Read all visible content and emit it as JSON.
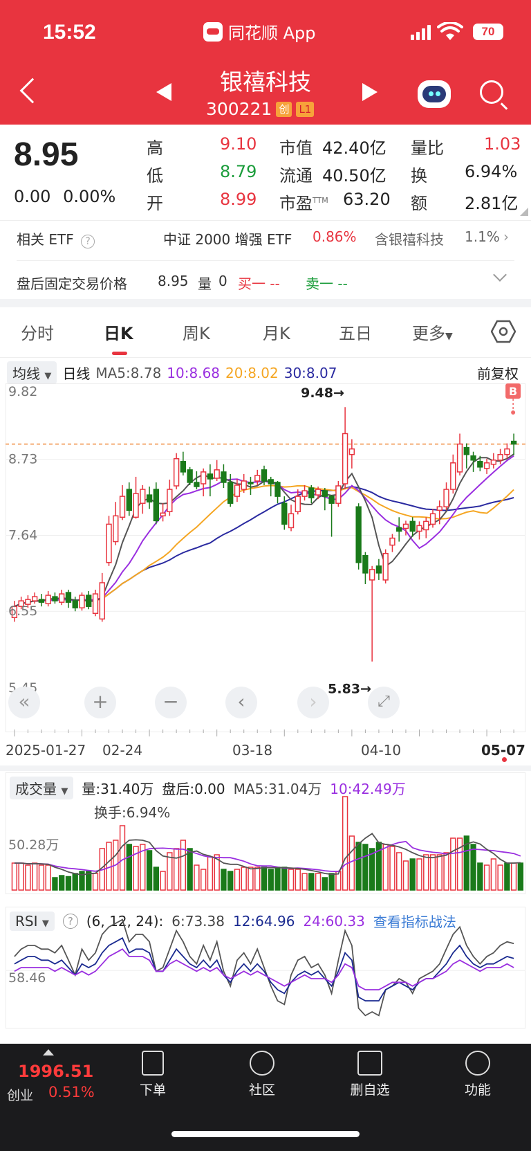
{
  "status_bar": {
    "time": "15:52",
    "app_label": "同花顺 App",
    "battery": "70"
  },
  "header": {
    "stock_name": "银禧科技",
    "stock_code": "300221",
    "tag_board": "创",
    "tag_level": "L1"
  },
  "quote": {
    "price": "8.95",
    "change": "0.00",
    "change_pct": "0.00%",
    "rows": [
      {
        "l1": "高",
        "v1": "9.10",
        "l2": "市值",
        "v2": "42.40亿",
        "l3": "量比",
        "v3": "1.03"
      },
      {
        "l1": "低",
        "v1": "8.79",
        "l2": "流通",
        "v2": "40.50亿",
        "l3": "换",
        "v3": "6.94%"
      },
      {
        "l1": "开",
        "v1": "8.99",
        "l2": "市盈",
        "v2": "63.20",
        "l3": "额",
        "v3": "2.81亿"
      }
    ],
    "ttm": "TTM"
  },
  "etf": {
    "label": "相关 ETF",
    "name": "中证 2000 增强 ETF",
    "pct": "0.86%",
    "contains": "含银禧科技",
    "weight": "1.1%"
  },
  "after_hours": {
    "label": "盘后固定交易价格",
    "price": "8.95",
    "vol_label": "量",
    "vol": "0",
    "buy": "买一 --",
    "sell": "卖一 --"
  },
  "tabs": [
    "分时",
    "日K",
    "周K",
    "月K",
    "五日",
    "更多"
  ],
  "kline": {
    "chip": "均线",
    "period": "日线",
    "ma5": "MA5:8.78",
    "ma10": "10:8.68",
    "ma20": "20:8.02",
    "ma30": "30:8.07",
    "adjust": "前复权",
    "y_labels": [
      "9.82",
      "8.73",
      "7.64",
      "6.55",
      "5.45"
    ],
    "high_mark": "9.48→",
    "low_mark": "5.83→",
    "b_mark": "B",
    "dates": [
      "2025-01-27",
      "02-24",
      "03-18",
      "04-10",
      "05-07"
    ]
  },
  "volume": {
    "chip": "成交量",
    "vol": "量:31.40万",
    "after": "盘后:0.00",
    "ma5": "MA5:31.04万",
    "ma10": "10:42.49万",
    "turnover": "换手:6.94%",
    "y_label": "50.28万"
  },
  "rsi": {
    "chip": "RSI",
    "params": "(6, 12, 24):",
    "r6": "6:73.38",
    "r12": "12:64.96",
    "r24": "24:60.33",
    "link": "查看指标战法",
    "y_label": "58.46"
  },
  "bottom": {
    "index_value": "1996.51",
    "index_name": "创业",
    "index_pct": "0.51%",
    "nav": [
      "下单",
      "社区",
      "删自选",
      "功能"
    ]
  },
  "colors": {
    "up": "#e8343f",
    "down": "#1a7a1a",
    "ma5": "#555555",
    "ma10": "#9a2fe0",
    "ma20": "#f5a623",
    "ma30": "#2a2aa0"
  },
  "chart_data": [
    {
      "type": "candlestick",
      "title": "",
      "ylim": [
        5.45,
        9.82
      ],
      "x_ticks": [
        "2025-01-27",
        "02-24",
        "03-18",
        "04-10",
        "05-07"
      ],
      "candles": [
        [
          6.46,
          6.62,
          6.7,
          6.4
        ],
        [
          6.62,
          6.7,
          6.76,
          6.58
        ],
        [
          6.65,
          6.72,
          6.78,
          6.6
        ],
        [
          6.7,
          6.76,
          6.82,
          6.66
        ],
        [
          6.72,
          6.68,
          6.8,
          6.62
        ],
        [
          6.66,
          6.78,
          6.84,
          6.62
        ],
        [
          6.76,
          6.7,
          6.82,
          6.66
        ],
        [
          6.68,
          6.8,
          6.86,
          6.64
        ],
        [
          6.82,
          6.68,
          6.86,
          6.6
        ],
        [
          6.7,
          6.6,
          6.76,
          6.55
        ],
        [
          6.6,
          6.78,
          6.82,
          6.56
        ],
        [
          6.78,
          6.62,
          6.84,
          6.58
        ],
        [
          6.52,
          6.8,
          6.86,
          6.48
        ],
        [
          6.44,
          6.96,
          7.1,
          6.4
        ],
        [
          7.25,
          7.8,
          7.92,
          7.2
        ],
        [
          7.55,
          7.92,
          8.12,
          7.5
        ],
        [
          7.9,
          8.2,
          8.36,
          7.86
        ],
        [
          8.3,
          8.0,
          8.4,
          7.92
        ],
        [
          7.9,
          8.24,
          8.48,
          7.88
        ],
        [
          8.1,
          8.3,
          8.36,
          7.95
        ],
        [
          8.22,
          8.12,
          8.34,
          8.02
        ],
        [
          8.3,
          7.85,
          8.4,
          7.8
        ],
        [
          7.92,
          7.96,
          8.1,
          7.84
        ],
        [
          7.98,
          8.3,
          8.44,
          7.92
        ],
        [
          8.35,
          8.74,
          8.82,
          8.3
        ],
        [
          8.7,
          8.55,
          8.84,
          8.5
        ],
        [
          8.58,
          8.4,
          8.62,
          8.36
        ],
        [
          8.4,
          8.34,
          8.56,
          8.3
        ],
        [
          8.38,
          8.55,
          8.6,
          8.2
        ],
        [
          8.52,
          8.45,
          8.66,
          8.2
        ],
        [
          8.46,
          8.58,
          8.72,
          8.42
        ],
        [
          8.55,
          8.4,
          8.66,
          8.32
        ],
        [
          8.4,
          8.1,
          8.52,
          8.05
        ],
        [
          8.2,
          8.36,
          8.45,
          8.12
        ],
        [
          8.3,
          8.42,
          8.52,
          8.25
        ],
        [
          8.4,
          8.38,
          8.48,
          8.22
        ],
        [
          8.42,
          8.5,
          8.58,
          8.36
        ],
        [
          8.58,
          8.42,
          8.64,
          8.36
        ],
        [
          8.44,
          8.38,
          8.48,
          8.2
        ],
        [
          8.4,
          8.2,
          8.42,
          8.1
        ],
        [
          8.1,
          7.8,
          8.2,
          7.72
        ],
        [
          7.75,
          7.95,
          8.08,
          7.7
        ],
        [
          7.98,
          8.2,
          8.3,
          7.94
        ],
        [
          8.2,
          8.28,
          8.36,
          8.14
        ],
        [
          8.32,
          8.18,
          8.36,
          8.1
        ],
        [
          8.22,
          8.3,
          8.34,
          8.16
        ],
        [
          8.28,
          8.2,
          8.32,
          8.0
        ],
        [
          8.2,
          8.1,
          8.22,
          7.62
        ],
        [
          8.1,
          8.35,
          8.42,
          8.05
        ],
        [
          8.38,
          9.1,
          9.48,
          8.3
        ],
        [
          8.8,
          8.88,
          9.02,
          8.6
        ],
        [
          8.05,
          7.25,
          8.1,
          7.15
        ],
        [
          7.35,
          7.1,
          7.4,
          6.94
        ],
        [
          7.0,
          7.15,
          7.2,
          5.83
        ],
        [
          7.2,
          7.1,
          7.3,
          7.0
        ],
        [
          7.0,
          7.38,
          7.44,
          6.95
        ],
        [
          7.5,
          7.6,
          7.66,
          7.4
        ],
        [
          7.75,
          7.7,
          7.9,
          7.55
        ],
        [
          7.74,
          7.8,
          7.85,
          7.64
        ],
        [
          7.84,
          7.7,
          7.9,
          7.62
        ],
        [
          7.7,
          7.78,
          7.84,
          7.58
        ],
        [
          7.72,
          7.84,
          7.9,
          7.6
        ],
        [
          7.8,
          7.95,
          8.02,
          7.75
        ],
        [
          8.0,
          8.05,
          8.14,
          7.8
        ],
        [
          8.05,
          8.3,
          8.4,
          8.0
        ],
        [
          8.3,
          8.68,
          8.8,
          8.24
        ],
        [
          8.55,
          8.95,
          9.1,
          8.5
        ],
        [
          8.9,
          8.8,
          8.96,
          8.6
        ],
        [
          8.78,
          8.72,
          8.84,
          8.55
        ],
        [
          8.7,
          8.62,
          8.78,
          8.56
        ],
        [
          8.6,
          8.68,
          8.74,
          8.52
        ],
        [
          8.66,
          8.72,
          8.82,
          8.6
        ],
        [
          8.72,
          8.8,
          8.88,
          8.66
        ],
        [
          8.8,
          8.88,
          8.96,
          8.74
        ],
        [
          8.99,
          8.95,
          9.1,
          8.79
        ]
      ]
    },
    {
      "type": "bar",
      "title": "",
      "ylabel": "成交量",
      "ylim": [
        0,
        100
      ],
      "values": [
        26,
        26,
        24,
        26,
        24,
        24,
        12,
        14,
        13,
        16,
        18,
        18,
        16,
        40,
        46,
        48,
        62,
        44,
        42,
        44,
        38,
        22,
        18,
        36,
        40,
        48,
        40,
        24,
        20,
        32,
        34,
        20,
        18,
        20,
        22,
        22,
        22,
        22,
        20,
        22,
        22,
        20,
        20,
        16,
        16,
        16,
        12,
        16,
        18,
        90,
        52,
        46,
        44,
        40,
        46,
        44,
        42,
        36,
        28,
        30,
        30,
        34,
        34,
        34,
        36,
        50,
        50,
        52,
        44,
        26,
        24,
        30,
        24,
        26,
        26,
        26
      ],
      "down_days": [
        6,
        7,
        8,
        9,
        10,
        11,
        17,
        20,
        21,
        26,
        31,
        32,
        37,
        38,
        39,
        40,
        44,
        46,
        47,
        51,
        52,
        53,
        54,
        59,
        67,
        68,
        69,
        73,
        75
      ]
    },
    {
      "type": "line",
      "title": "",
      "series": [
        {
          "name": "RSI6",
          "values": [
            66,
            70,
            72,
            72,
            70,
            70,
            68,
            72,
            64,
            56,
            70,
            64,
            68,
            78,
            82,
            84,
            86,
            74,
            78,
            78,
            74,
            58,
            60,
            70,
            80,
            74,
            66,
            62,
            72,
            64,
            74,
            58,
            50,
            64,
            68,
            62,
            70,
            60,
            50,
            42,
            40,
            56,
            64,
            66,
            60,
            62,
            56,
            46,
            64,
            80,
            72,
            38,
            34,
            36,
            34,
            48,
            50,
            54,
            52,
            46,
            54,
            56,
            58,
            62,
            70,
            78,
            82,
            72,
            66,
            62,
            66,
            68,
            72,
            74,
            73
          ]
        },
        {
          "name": "RSI12",
          "values": [
            62,
            64,
            66,
            66,
            64,
            64,
            62,
            64,
            60,
            56,
            62,
            60,
            62,
            68,
            72,
            74,
            76,
            68,
            70,
            70,
            68,
            58,
            58,
            64,
            70,
            66,
            62,
            60,
            64,
            60,
            64,
            56,
            52,
            58,
            62,
            58,
            62,
            58,
            52,
            48,
            46,
            52,
            56,
            58,
            56,
            58,
            54,
            50,
            58,
            68,
            64,
            44,
            42,
            42,
            42,
            48,
            50,
            52,
            50,
            48,
            52,
            54,
            54,
            58,
            62,
            68,
            72,
            66,
            62,
            60,
            62,
            62,
            64,
            66,
            65
          ]
        },
        {
          "name": "RSI24",
          "values": [
            58,
            60,
            60,
            60,
            60,
            60,
            58,
            60,
            58,
            56,
            58,
            56,
            58,
            62,
            66,
            68,
            70,
            66,
            66,
            66,
            64,
            58,
            58,
            62,
            64,
            62,
            60,
            58,
            60,
            58,
            60,
            56,
            54,
            56,
            58,
            56,
            58,
            56,
            54,
            52,
            50,
            52,
            54,
            56,
            54,
            54,
            54,
            52,
            56,
            62,
            60,
            50,
            48,
            48,
            48,
            50,
            52,
            52,
            52,
            50,
            52,
            54,
            54,
            56,
            58,
            62,
            64,
            62,
            60,
            58,
            60,
            60,
            60,
            62,
            60
          ]
        }
      ]
    }
  ]
}
